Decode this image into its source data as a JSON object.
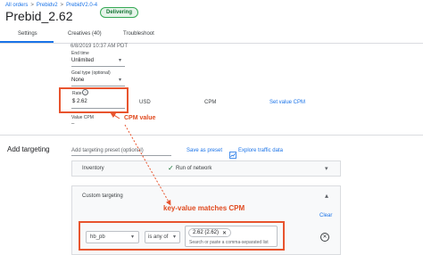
{
  "header": {
    "breadcrumb": [
      "All orders",
      "Prebidv2",
      "PrebidV2.0-4"
    ],
    "breadcrumb_sep": ">",
    "title": "Prebid_2.62",
    "status": "Delivering"
  },
  "tabs": [
    {
      "label": "Settings",
      "active": true
    },
    {
      "label": "Creatives (40)",
      "active": false
    },
    {
      "label": "Troubleshoot",
      "active": false
    }
  ],
  "settings": {
    "faded_text": "6/8/2019  10:37 AM  PDT",
    "end_time": {
      "label": "End time",
      "value": "Unlimited"
    },
    "goal_type": {
      "label": "Goal type (optional)",
      "value": "None"
    },
    "rate": {
      "label": "Rate",
      "value": "$ 2.62",
      "currency": "USD",
      "unit": "CPM",
      "link": "Set value CPM"
    },
    "value_cpm": {
      "label": "Value CPM",
      "value": "–"
    }
  },
  "annotations": {
    "cpm_value": "CPM value",
    "key_value": "key-value matches CPM",
    "color": "#e8542e"
  },
  "add_targeting": {
    "title": "Add targeting",
    "preset_placeholder": "Add targeting preset (optional)",
    "save_preset": "Save as preset",
    "explore": "Explore traffic data",
    "inventory": {
      "label": "Inventory",
      "value": "Run of network"
    },
    "custom": {
      "label": "Custom targeting",
      "clear": "Clear",
      "key": "hb_pb",
      "operator": "is any of",
      "chip": "2.62 (2.62)",
      "search_placeholder": "Search or paste a comma-separated list"
    }
  }
}
